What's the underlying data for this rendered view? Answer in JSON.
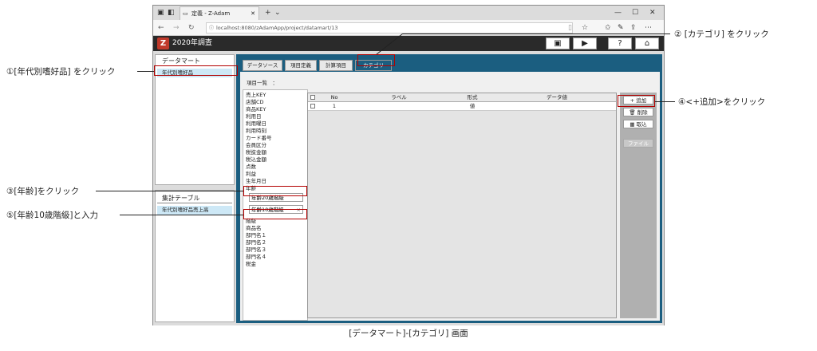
{
  "browser": {
    "tab_title": "定義 - Z-Adam",
    "url": "localhost:8080/zAdamApp/project/datamart/13"
  },
  "app": {
    "title": "2020年調査",
    "left": {
      "datamart_title": "データマート",
      "datamart_item": "年代別嗜好品",
      "agg_title": "集計テーブル",
      "agg_item": "年代別嗜好品売上高"
    },
    "tabs": [
      "データソース",
      "項目定義",
      "計算項目",
      "カテゴリ"
    ],
    "item_list_label": "項目一覧　：",
    "items_top": [
      "売上KEY",
      "店舗CD",
      "商品KEY",
      "利用日",
      "利用曜日",
      "利用時刻",
      "カード番号",
      "会員区分",
      "税抜金額",
      "税込金額",
      "点数",
      "利益",
      "生年月日",
      "年齢"
    ],
    "category_input_1": "年齢20歳階級",
    "category_input_2": "年齢10歳階級",
    "clear_mark": "×",
    "items_bottom": [
      "階級",
      "商品名",
      "部門名１",
      "部門名２",
      "部門名３",
      "部門名４",
      "税金"
    ],
    "grid": {
      "columns": [
        "No",
        "ラベル",
        "形式",
        "データ値"
      ],
      "row": {
        "no": "1",
        "label": "",
        "type": "値",
        "value": ""
      }
    },
    "buttons": {
      "add": "追加",
      "delete": "削除",
      "import": "取込",
      "file": "ファイル"
    }
  },
  "annotations": {
    "a1": "①[年代別嗜好品] をクリック",
    "a2": "② [カテゴリ] をクリック",
    "a3": "③[年齢]をクリック",
    "a4": "④<+追加>をクリック",
    "a5": "⑤[年齢10歳階級]と入力"
  },
  "caption": "[データマート]-[カテゴリ] 画面"
}
